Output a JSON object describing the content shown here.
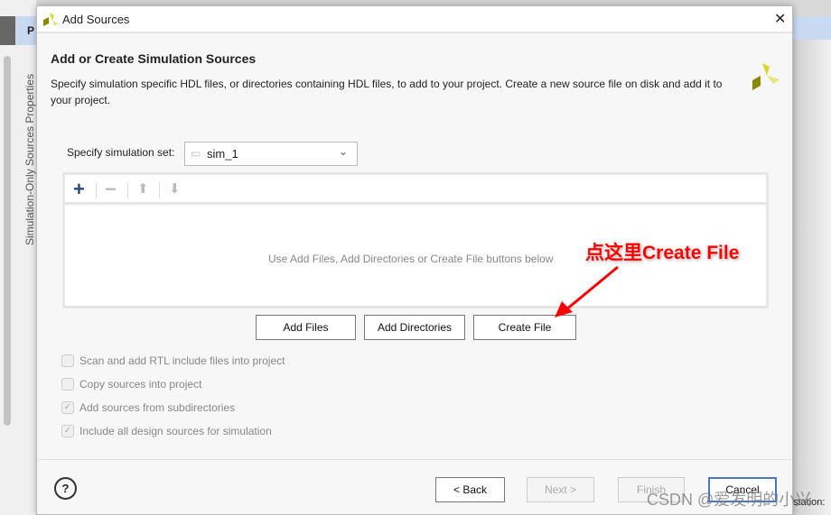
{
  "background": {
    "side_tab": "Simulation-Only Sources Properties",
    "top_letter": "P",
    "right_label": "station:"
  },
  "dialog": {
    "title": "Add Sources",
    "heading": "Add or Create Simulation Sources",
    "description": "Specify simulation specific HDL files, or directories containing HDL files, to add to your project. Create a new source file on disk and add it to your project.",
    "sim_set_label": "Specify simulation set:",
    "sim_set_value": "sim_1",
    "empty_hint": "Use Add Files, Add Directories or Create File buttons below",
    "buttons": {
      "add_files": "Add Files",
      "add_directories": "Add Directories",
      "create_file": "Create File"
    },
    "options": [
      {
        "label": "Scan and add RTL include files into project",
        "checked": false
      },
      {
        "label": "Copy sources into project",
        "checked": false
      },
      {
        "label": "Add sources from subdirectories",
        "checked": true
      },
      {
        "label": "Include all design sources for simulation",
        "checked": true
      }
    ],
    "footer": {
      "help": "?",
      "back": "< Back",
      "next": "Next >",
      "finish": "Finish",
      "cancel": "Cancel"
    }
  },
  "annotation": {
    "text": "点这里Create File",
    "color": "#ff0000"
  },
  "watermark": "CSDN @爱发明的小兴"
}
